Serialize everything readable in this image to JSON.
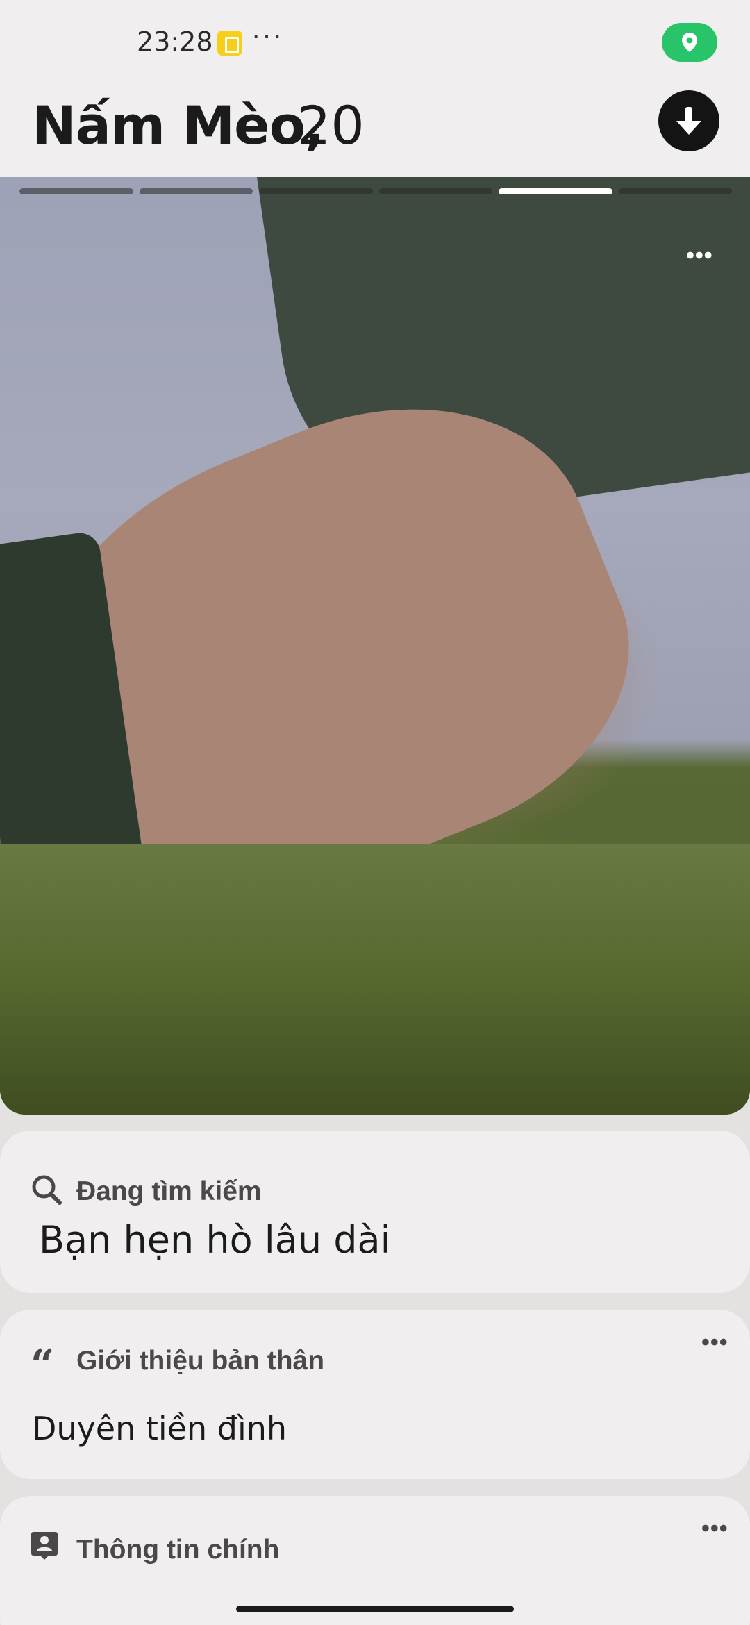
{
  "status_bar": {
    "time": "23:28",
    "more": "···",
    "notification_icon": "app-notification-icon",
    "location_icon": "location-pin-icon",
    "location_color": "#27c46a"
  },
  "profile": {
    "name": "Nấm Mèo,",
    "age": "20",
    "collapse_icon": "arrow-down-icon"
  },
  "photo": {
    "total_photos": 6,
    "current_photo": 5,
    "menu": "•••"
  },
  "cards": {
    "looking_for": {
      "icon": "search-icon",
      "label": "Đang tìm kiếm",
      "value": "Bạn hẹn hò lâu dài"
    },
    "about": {
      "icon": "quote-icon",
      "icon_glyph": "“",
      "label": "Giới thiệu bản thân",
      "value": "Duyên tiền đình",
      "menu": "•••"
    },
    "basic_info": {
      "icon": "profile-card-icon",
      "label": "Thông tin chính",
      "menu": "•••"
    }
  }
}
